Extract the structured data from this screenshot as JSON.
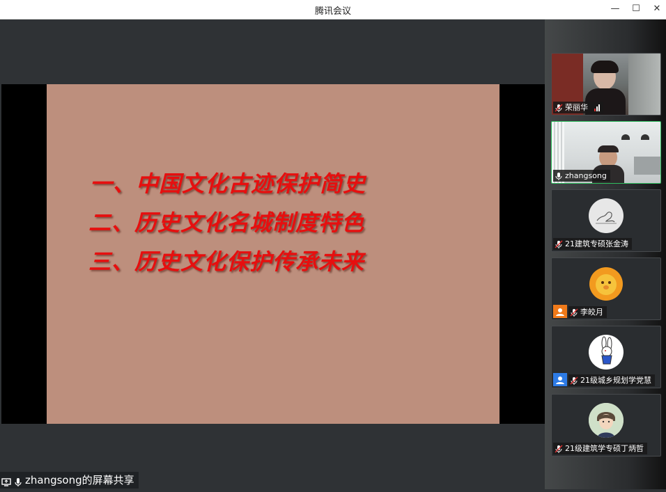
{
  "window": {
    "title": "腾讯会议"
  },
  "slide": {
    "lines": [
      "一、中国文化古迹保护简史",
      "二、历史文化名城制度特色",
      "三、历史文化保护传承未来"
    ]
  },
  "share_label": "zhangsong的屏幕共享",
  "participants": [
    {
      "name": "荣丽华",
      "muted": true,
      "video": true
    },
    {
      "name": "zhangsong",
      "muted": false,
      "video": true,
      "active": true
    },
    {
      "name": "21建筑专硕张金涛",
      "muted": true,
      "video": false
    },
    {
      "name": "李皎月",
      "muted": true,
      "video": false
    },
    {
      "name": "21级城乡规划学党慧",
      "muted": true,
      "video": false
    },
    {
      "name": "21级建筑学专硕丁炳哲",
      "muted": true,
      "video": false
    }
  ],
  "colors": {
    "slide_bg": "#bd8f7d",
    "slide_text": "#e60f0f",
    "active_border": "#2fbf5f"
  }
}
